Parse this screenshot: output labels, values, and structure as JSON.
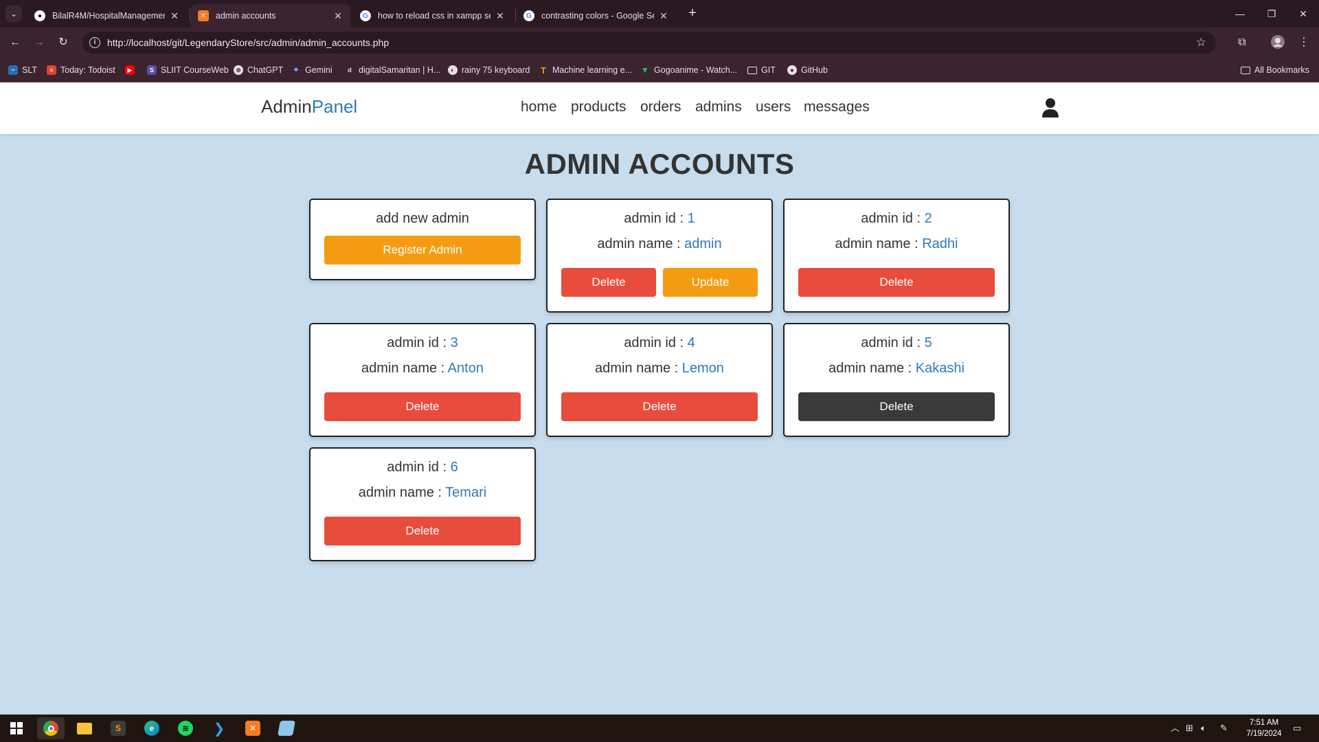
{
  "browser": {
    "tabs": [
      {
        "title": "BilalR4M/HospitalManagement",
        "icon": "github-icon"
      },
      {
        "title": "admin accounts",
        "icon": "xampp-icon"
      },
      {
        "title": "how to reload css in xampp ser",
        "icon": "google-icon"
      },
      {
        "title": "contrasting colors - Google Sea",
        "icon": "google-icon"
      }
    ],
    "url": "http://localhost/git/LegendaryStore/src/admin/admin_accounts.php",
    "bookmarks": [
      "SLT",
      "Today: Todoist",
      "",
      "SLIIT CourseWeb",
      "ChatGPT",
      "Gemini",
      "digitalSamaritan | H...",
      "rainy 75 keyboard",
      "Machine learning e...",
      "Gogoanime - Watch...",
      "GIT",
      "GitHub"
    ],
    "all_bookmarks": "All Bookmarks"
  },
  "header": {
    "logo_main": "Admin",
    "logo_accent": "Panel",
    "nav": [
      "home",
      "products",
      "orders",
      "admins",
      "users",
      "messages"
    ]
  },
  "page": {
    "title": "ADMIN ACCOUNTS",
    "add_card": {
      "label": "add new admin",
      "button": "Register Admin"
    },
    "id_label": "admin id : ",
    "name_label": "admin name : ",
    "admins": [
      {
        "id": "1",
        "name": "admin",
        "delete": "Delete",
        "update": "Update"
      },
      {
        "id": "2",
        "name": "Radhi",
        "delete": "Delete"
      },
      {
        "id": "3",
        "name": "Anton",
        "delete": "Delete"
      },
      {
        "id": "4",
        "name": "Lemon",
        "delete": "Delete"
      },
      {
        "id": "5",
        "name": "Kakashi",
        "delete": "Delete"
      },
      {
        "id": "6",
        "name": "Temari",
        "delete": "Delete"
      }
    ]
  },
  "taskbar": {
    "time": "7:51 AM",
    "date": "7/19/2024"
  },
  "colors": {
    "accent": "#2d7ab8",
    "delete": "#e74c3c",
    "register": "#f39c12",
    "page_bg": "#c7dcec"
  }
}
